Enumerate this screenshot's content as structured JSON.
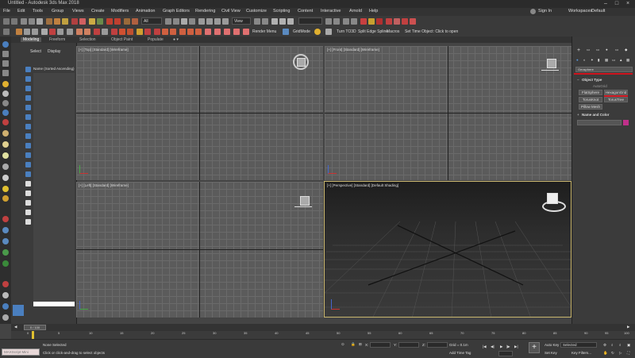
{
  "window": {
    "title": "Untitled - Autodesk 3ds Max 2018"
  },
  "menu": [
    "File",
    "Edit",
    "Tools",
    "Group",
    "Views",
    "Create",
    "Modifiers",
    "Animation",
    "Graph Editors",
    "Rendering",
    "Civil View",
    "Customize",
    "Scripting",
    "Content",
    "Interactive",
    "Arnold",
    "Help"
  ],
  "account": {
    "sign_in": "Sign In",
    "workspaces_label": "Workspaces:",
    "workspace": "Default"
  },
  "toolbar": {
    "selection_filter": "All",
    "view_dropdown": "View",
    "render_menu": "Render Menu",
    "grid_mode": "GridMode",
    "turn_label": "Turn TO3D",
    "split_label": "Split Edge Spline",
    "macros": "Macros",
    "set_object": "Set Time Object: Click to open"
  },
  "ribbon": {
    "tabs": [
      "Modeling",
      "Freeform",
      "Selection",
      "Object Paint",
      "Populate"
    ],
    "active": "Modeling"
  },
  "explorer": {
    "select_label": "Select",
    "display_label": "Display",
    "column_header": "Name (Sorted Ascending)"
  },
  "viewports": {
    "top": "[+] [Top] [Standard] [Wireframe]",
    "front": "[+] [Front] [Standard] [Wireframe]",
    "left": "[+] [Left] [Standard] [Wireframe]",
    "perspective": "[+] [Perspective] [Standard] [Default Shading]"
  },
  "command_panel": {
    "category": "Geosphere",
    "autogrid": "AutoGrid",
    "object_type_header": "Object Type",
    "buttons": [
      "FlatSphere",
      "HexagonGrid",
      "TorusKnot",
      "TorusTree",
      "Pillow Mesh"
    ],
    "name_color_header": "Name and Color"
  },
  "timeline": {
    "position": "0 / 100",
    "ticks": [
      "0",
      "5",
      "10",
      "15",
      "20",
      "25",
      "30",
      "35",
      "40",
      "45",
      "50",
      "55",
      "60",
      "65",
      "70",
      "75",
      "80",
      "85",
      "90",
      "95",
      "100"
    ]
  },
  "status": {
    "maxscript": "MAXScript Mini",
    "selection": "None Selected",
    "prompt": "Click or click-and-drag to select objects",
    "x_label": "X:",
    "y_label": "Y:",
    "z_label": "Z:",
    "grid": "Grid = 0.1m",
    "add_time_tag": "Add Time Tag",
    "autokey": "Auto Key",
    "selected": "Selected",
    "setkey": "Set Key",
    "key_filters": "Key Filters..."
  }
}
